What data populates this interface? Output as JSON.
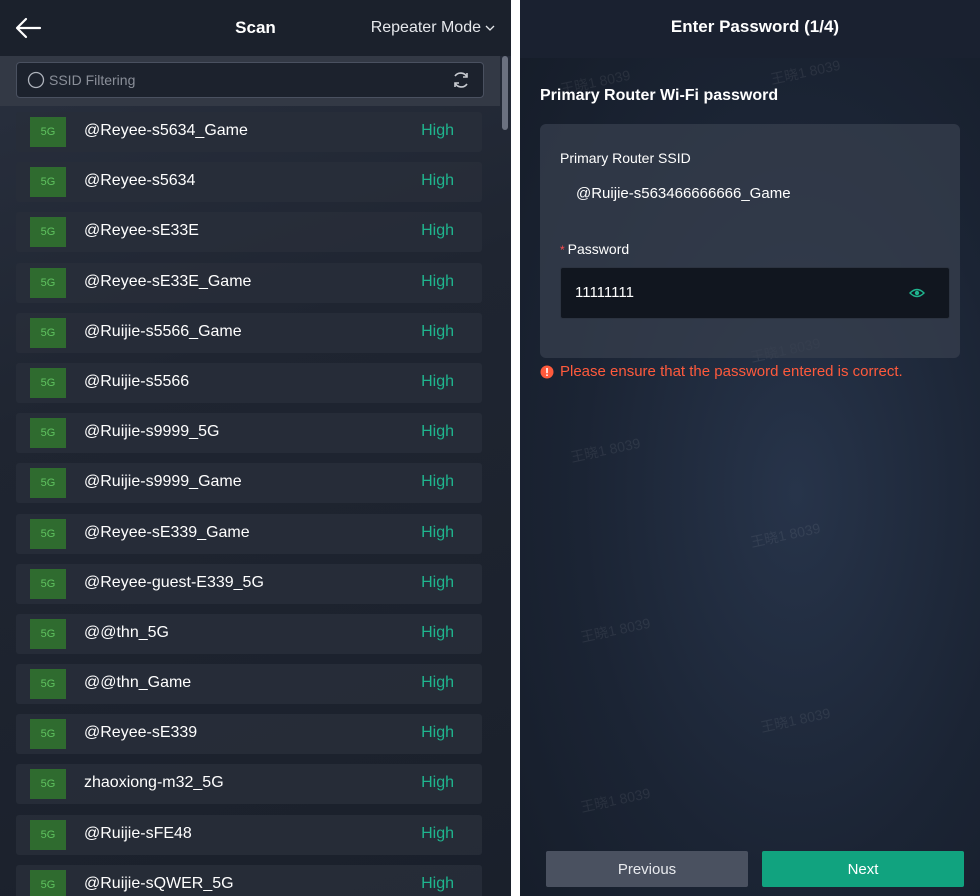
{
  "scan": {
    "title": "Scan",
    "mode": "Repeater Mode",
    "search_placeholder": "SSID Filtering",
    "networks": [
      {
        "band": "5G",
        "ssid": "@Reyee-s5634_Game",
        "signal": "High"
      },
      {
        "band": "5G",
        "ssid": "@Reyee-s5634",
        "signal": "High"
      },
      {
        "band": "5G",
        "ssid": "@Reyee-sE33E",
        "signal": "High"
      },
      {
        "band": "5G",
        "ssid": "@Reyee-sE33E_Game",
        "signal": "High"
      },
      {
        "band": "5G",
        "ssid": "@Ruijie-s5566_Game",
        "signal": "High"
      },
      {
        "band": "5G",
        "ssid": "@Ruijie-s5566",
        "signal": "High"
      },
      {
        "band": "5G",
        "ssid": "@Ruijie-s9999_5G",
        "signal": "High"
      },
      {
        "band": "5G",
        "ssid": "@Ruijie-s9999_Game",
        "signal": "High"
      },
      {
        "band": "5G",
        "ssid": "@Reyee-sE339_Game",
        "signal": "High"
      },
      {
        "band": "5G",
        "ssid": "@Reyee-guest-E339_5G",
        "signal": "High"
      },
      {
        "band": "5G",
        "ssid": "@@thn_5G",
        "signal": "High"
      },
      {
        "band": "5G",
        "ssid": "@@thn_Game",
        "signal": "High"
      },
      {
        "band": "5G",
        "ssid": "@Reyee-sE339",
        "signal": "High"
      },
      {
        "band": "5G",
        "ssid": "zhaoxiong-m32_5G",
        "signal": "High"
      },
      {
        "band": "5G",
        "ssid": "@Ruijie-sFE48",
        "signal": "High"
      },
      {
        "band": "5G",
        "ssid": "@Ruijie-sQWER_5G",
        "signal": "High"
      }
    ]
  },
  "password": {
    "title": "Enter Password (1/4)",
    "section_title": "Primary Router Wi-Fi password",
    "ssid_label": "Primary Router SSID",
    "ssid_value": "@Ruijie-s563466666666_Game",
    "required_mark": "*",
    "password_label": "Password",
    "password_value": "11111111",
    "error_message": "Please ensure that the password entered is correct.",
    "previous_label": "Previous",
    "next_label": "Next"
  },
  "watermark_text": "王晓1 8039",
  "colors": {
    "signal_high": "#1fb58e",
    "badge_bg": "#2f6b2f",
    "badge_text": "#5fc25f",
    "error": "#ff5a3c",
    "next_button": "#11a37f",
    "previous_button": "#4a5160"
  }
}
